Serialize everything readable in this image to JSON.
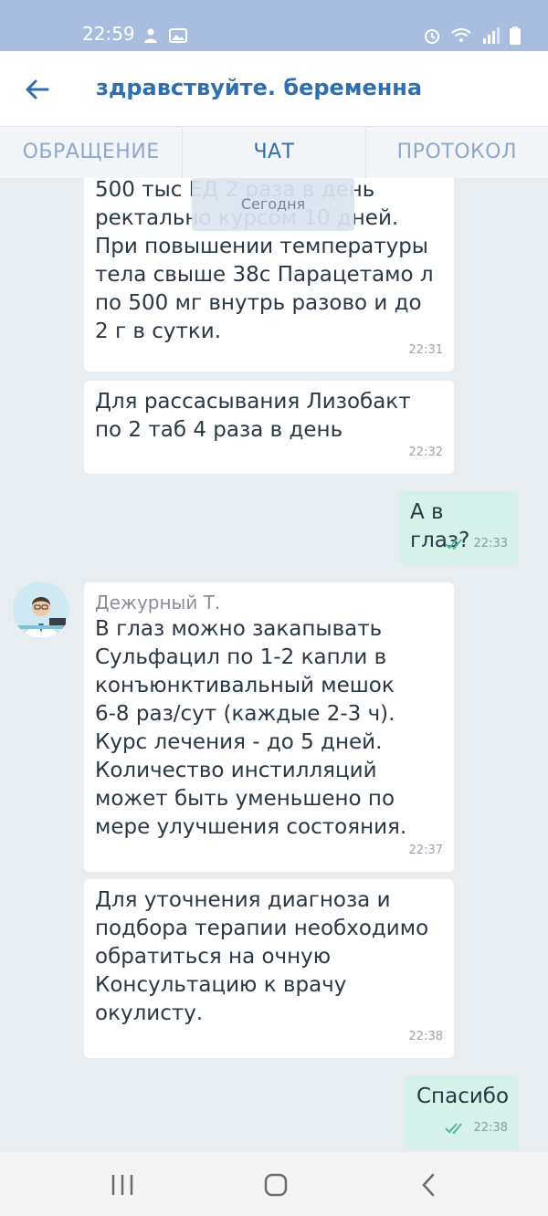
{
  "status": {
    "time": "22:59",
    "icons_left": [
      "person-notification-icon",
      "gallery-icon"
    ],
    "icons_right": [
      "alarm-icon",
      "wifi-icon",
      "signal-icon",
      "battery-icon"
    ]
  },
  "appbar": {
    "back_icon": "arrow-left-icon",
    "title": "здравствуйте. беременна"
  },
  "tabs": [
    {
      "label": "ОБРАЩЕНИЕ",
      "active": false
    },
    {
      "label": "ЧАТ",
      "active": true
    },
    {
      "label": "ПРОТОКОЛ",
      "active": false
    }
  ],
  "chat": {
    "date_separator": "Сегодня",
    "messages": [
      {
        "direction": "in",
        "lines": [
          "500 тыс ЕД 2 раза в день",
          "ректально курсом 10 дней.",
          "При повышении температуры",
          "тела свыше 38с Парацетамо л",
          "по 500 мг внутрь разово и до",
          "2 г в сутки."
        ],
        "time": "22:31"
      },
      {
        "direction": "in",
        "lines": [
          "Для рассасывания Лизобакт",
          "по 2 таб 4 раза в день"
        ],
        "time": "22:32"
      },
      {
        "direction": "out",
        "lines": [
          "А в глаз?"
        ],
        "time": "22:33"
      },
      {
        "direction": "in",
        "sender": "Дежурный Т.",
        "lines": [
          "В глаз можно закапывать",
          "Сульфацил по 1-2 капли в",
          "конъюнктивальный мешок",
          "6-8 раз/сут (каждые 2-3 ч).",
          "Курс лечения - до 5 дней.",
          "Количество инстилляций",
          "может быть уменьшено по",
          "мере улучшения состояния."
        ],
        "time": "22:37"
      },
      {
        "direction": "in",
        "lines": [
          "Для уточнения диагноза и",
          "подбора терапии необходимо",
          "обратиться на очную",
          "Консультацию к врачу",
          "окулисту."
        ],
        "time": "22:38"
      },
      {
        "direction": "out",
        "lines": [
          "Спасибо"
        ],
        "time": "22:38"
      }
    ]
  },
  "navbar": {
    "buttons": [
      "recent-apps-icon",
      "home-icon",
      "back-icon"
    ]
  },
  "colors": {
    "status_bar": "#a9bde0",
    "accent": "#2f6fae",
    "tab_inactive": "#8ba9cf",
    "outgoing_bubble": "#d6f1ea",
    "read_ticks": "#4fb8a3"
  }
}
